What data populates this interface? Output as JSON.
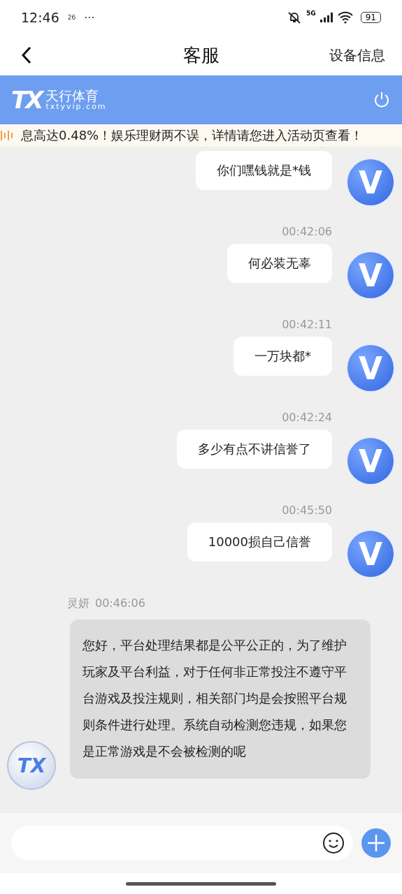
{
  "status_bar": {
    "time": "12:46",
    "date_label": "26",
    "more": "···",
    "battery": "91",
    "network": "5G"
  },
  "nav": {
    "title": "客服",
    "action": "设备信息"
  },
  "brand": {
    "logo": "TX",
    "name": "天行体育",
    "domain": "txtyvip.com"
  },
  "marquee": {
    "text": "息高达0.48%！娱乐理财两不误，详情请您进入活动页查看！"
  },
  "messages": [
    {
      "kind": "sent",
      "text": "你们嘿钱就是*钱",
      "avatar": "V"
    },
    {
      "kind": "sent",
      "time": "00:42:06",
      "text": "何必装无辜",
      "avatar": "V"
    },
    {
      "kind": "sent",
      "time": "00:42:11",
      "text": "一万块都*",
      "avatar": "V"
    },
    {
      "kind": "sent",
      "time": "00:42:24",
      "text": "多少有点不讲信誉了",
      "avatar": "V"
    },
    {
      "kind": "sent",
      "time": "00:45:50",
      "text": "10000损自己信誉",
      "avatar": "V"
    },
    {
      "kind": "received",
      "sender": "灵妍",
      "time": "00:46:06",
      "text": "您好，平台处理结果都是公平公正的，为了维护玩家及平台利益，对于任何非正常投注不遵守平台游戏及投注规则，相关部门均是会按照平台规则条件进行处理。系统自动检测您违规，如果您是正常游戏是不会被检测的呢",
      "avatar": "TX"
    }
  ]
}
